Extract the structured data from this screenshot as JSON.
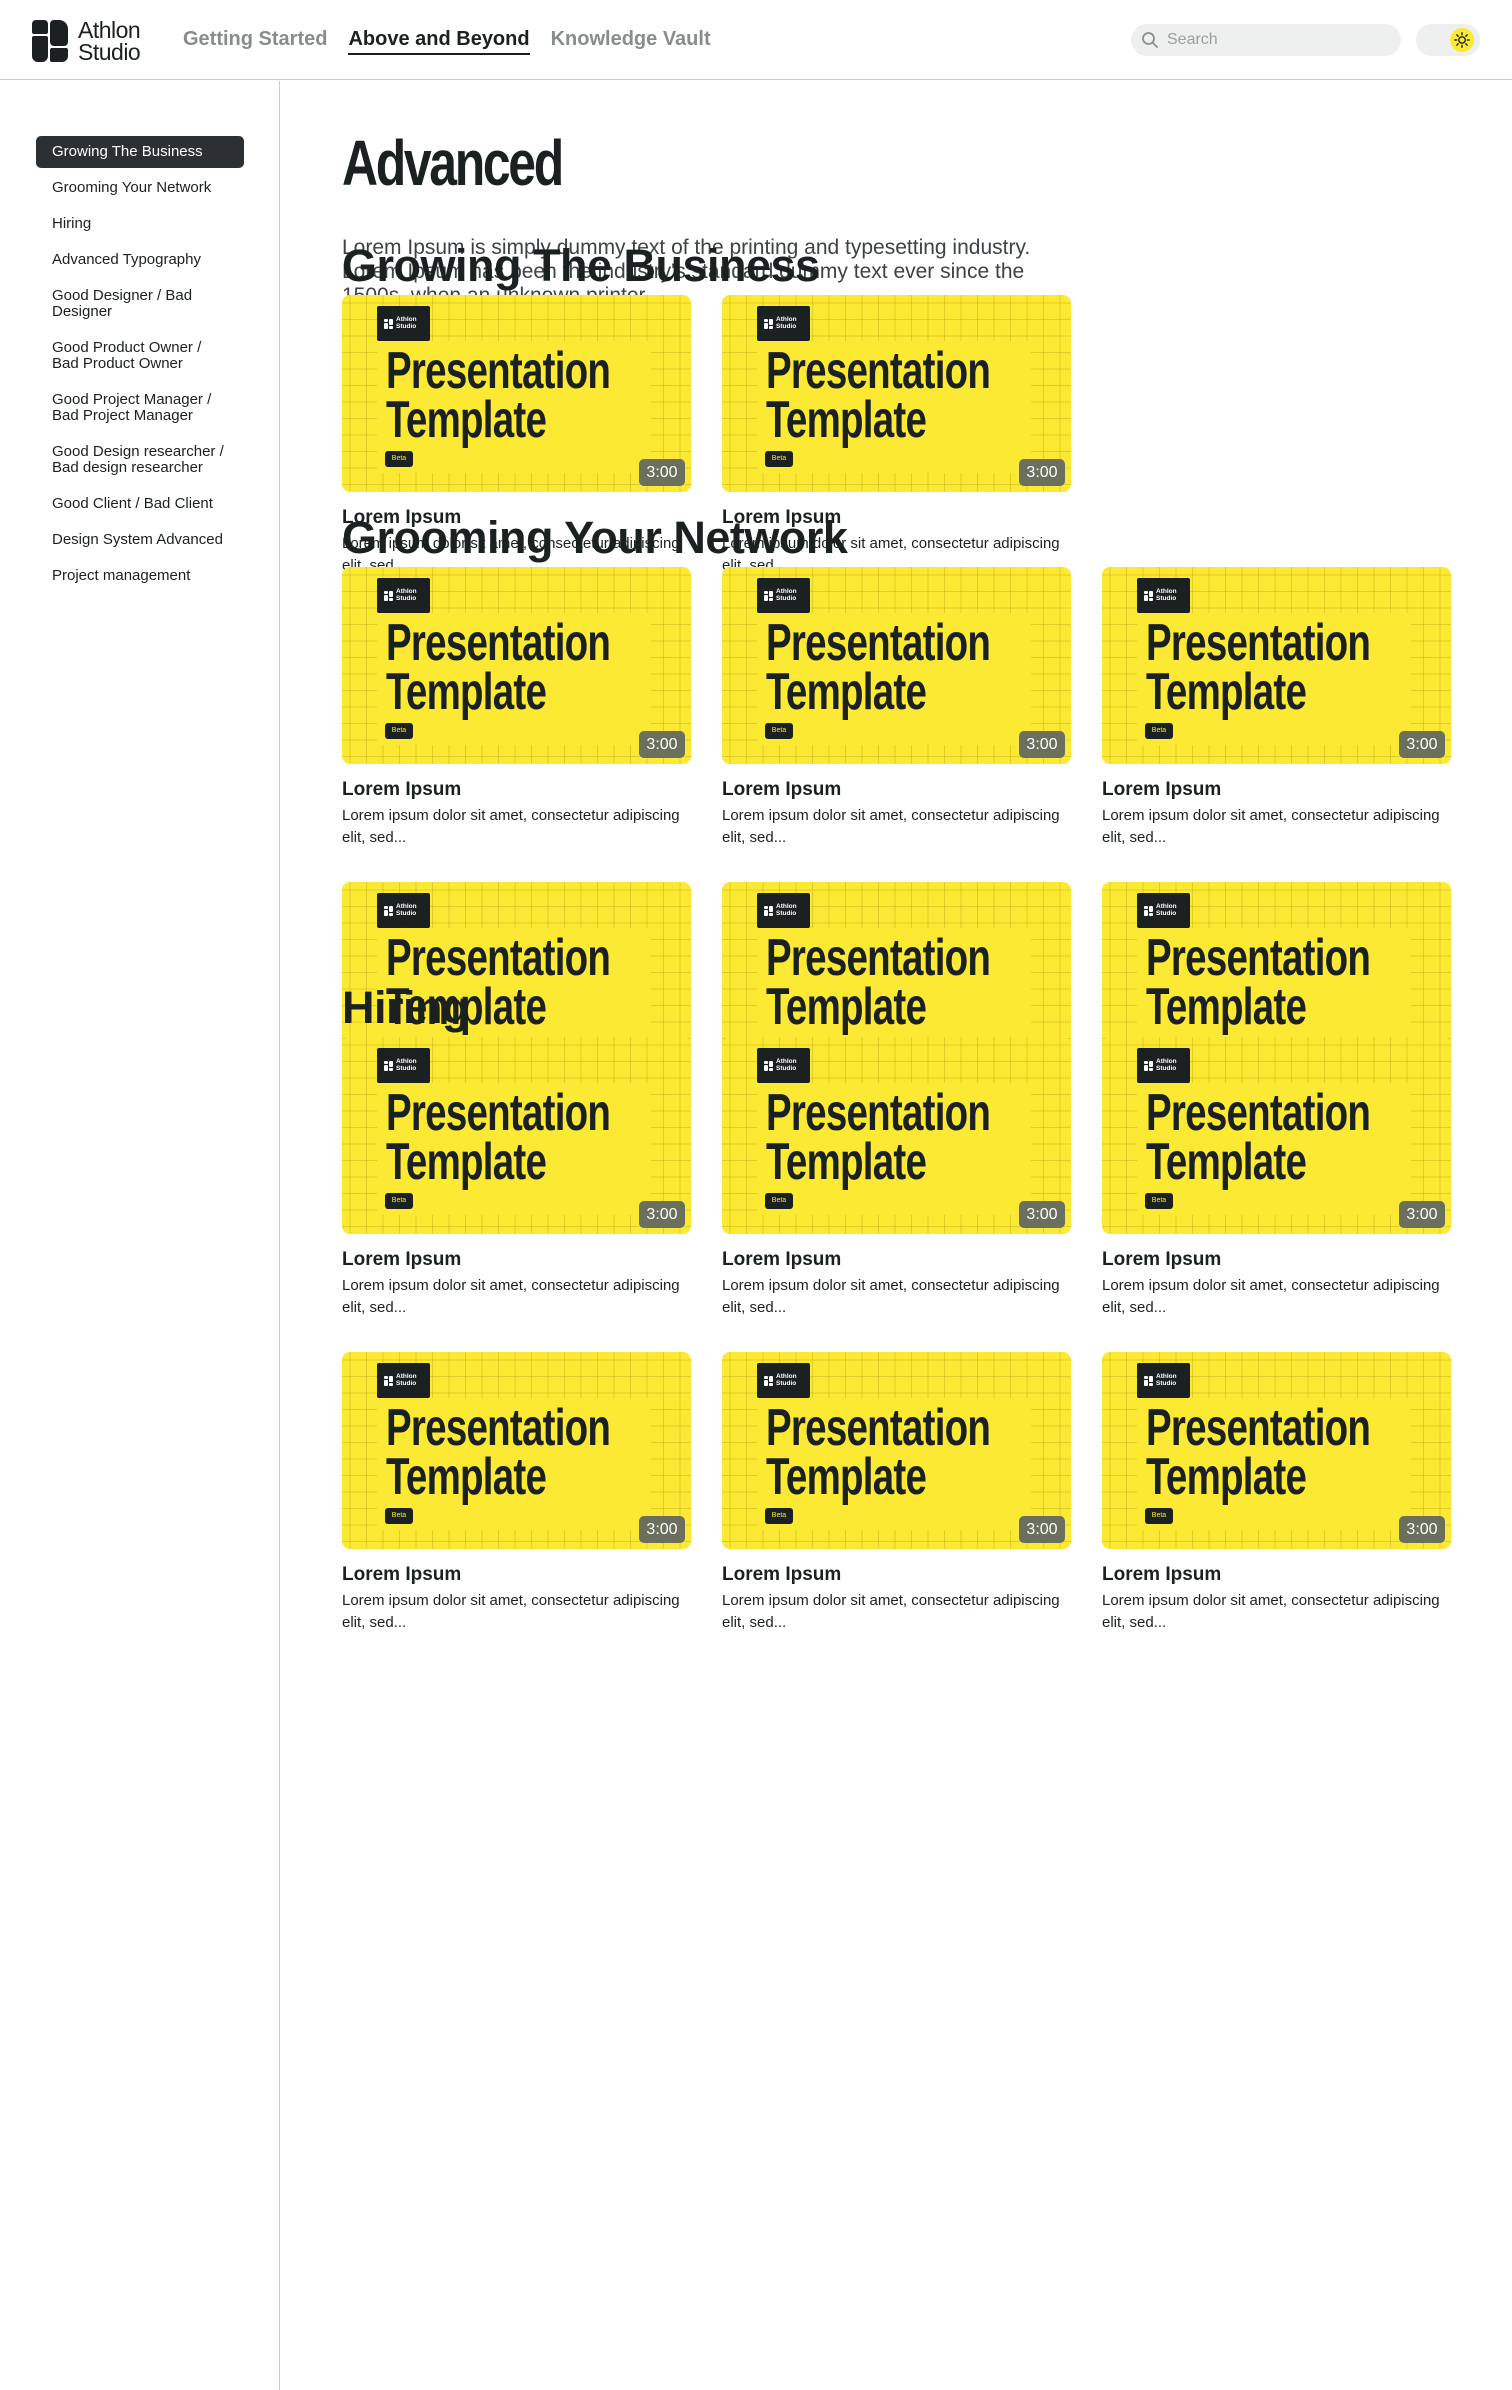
{
  "header": {
    "logo_line1": "Athlon",
    "logo_line2": "Studio",
    "nav": [
      "Getting Started",
      "Above and Beyond",
      "Knowledge Vault"
    ],
    "active_nav": 1,
    "search_placeholder": "Search",
    "theme_icon": "sun-icon"
  },
  "sidebar": {
    "active": 0,
    "items": [
      "Growing The Business",
      "Grooming Your Network",
      "Hiring",
      "Advanced Typography",
      "Good Designer / Bad Designer",
      "Good Product Owner / Bad Product Owner",
      "Good Project Manager / Bad Project Manager",
      "Good Design researcher / Bad design researcher",
      "Good Client / Bad Client",
      "Design System Advanced",
      "Project management"
    ]
  },
  "page": {
    "title": "Advanced",
    "description": "Lorem Ipsum is simply dummy text of the printing and typesetting industry. Lorem Ipsum has been the industry's standard dummy text ever since the 1500s, when an unknown printer"
  },
  "thumbnail": {
    "brand_line1": "Athlon",
    "brand_line2": "Studio",
    "title_line1": "Presentation",
    "title_line2": "Template",
    "badge": "Beta",
    "accent_color": "#fce934"
  },
  "sections": [
    {
      "title": "Growing The Business",
      "cards": [
        {
          "title": "Lorem Ipsum",
          "description": "Lorem ipsum dolor sit amet, consectetur adipiscing elit, sed...",
          "duration": "3:00"
        },
        {
          "title": "Lorem Ipsum",
          "description": "Lorem ipsum dolor sit amet, consectetur adipiscing elit, sed...",
          "duration": "3:00"
        }
      ]
    },
    {
      "title": "Grooming Your Network",
      "cards": [
        {
          "title": "Lorem Ipsum",
          "description": "Lorem ipsum dolor sit amet, consectetur adipiscing elit, sed...",
          "duration": "3:00"
        },
        {
          "title": "Lorem Ipsum",
          "description": "Lorem ipsum dolor sit amet, consectetur adipiscing elit, sed...",
          "duration": "3:00"
        },
        {
          "title": "Lorem Ipsum",
          "description": "Lorem ipsum dolor sit amet, consectetur adipiscing elit, sed...",
          "duration": "3:00"
        },
        {
          "title": "Lorem Ipsum",
          "description": "Lorem ipsum dolor sit amet, consectetur adipiscing elit, sed...",
          "duration": "3:00"
        },
        {
          "title": "Lorem Ipsum",
          "description": "Lorem ipsum dolor sit amet, consectetur adipiscing elit, sed...",
          "duration": "3:00"
        },
        {
          "title": "Lorem Ipsum",
          "description": "Lorem ipsum dolor sit amet, consectetur adipiscing elit, sed...",
          "duration": "3:00"
        }
      ]
    },
    {
      "title": "Hiring",
      "cards": [
        {
          "title": "Lorem Ipsum",
          "description": "Lorem ipsum dolor sit amet, consectetur adipiscing elit, sed...",
          "duration": "3:00"
        },
        {
          "title": "Lorem Ipsum",
          "description": "Lorem ipsum dolor sit amet, consectetur adipiscing elit, sed...",
          "duration": "3:00"
        },
        {
          "title": "Lorem Ipsum",
          "description": "Lorem ipsum dolor sit amet, consectetur adipiscing elit, sed...",
          "duration": "3:00"
        },
        {
          "title": "Lorem Ipsum",
          "description": "Lorem ipsum dolor sit amet, consectetur adipiscing elit, sed...",
          "duration": "3:00"
        },
        {
          "title": "Lorem Ipsum",
          "description": "Lorem ipsum dolor sit amet, consectetur adipiscing elit, sed...",
          "duration": "3:00"
        },
        {
          "title": "Lorem Ipsum",
          "description": "Lorem ipsum dolor sit amet, consectetur adipiscing elit, sed...",
          "duration": "3:00"
        }
      ]
    }
  ]
}
